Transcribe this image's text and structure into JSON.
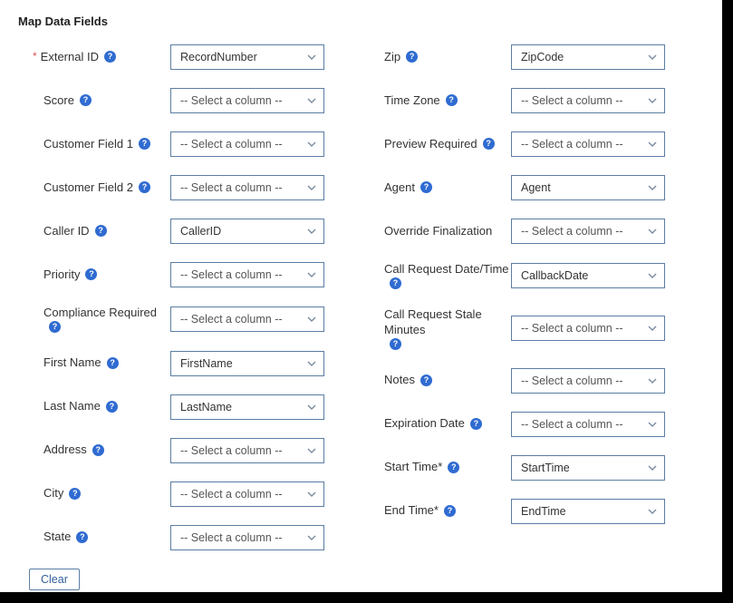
{
  "title": "Map Data Fields",
  "placeholder": "-- Select a column --",
  "left": [
    {
      "key": "external-id",
      "label": "External ID",
      "required": true,
      "help": true,
      "value": "RecordNumber"
    },
    {
      "key": "score",
      "label": "Score",
      "required": false,
      "help": true,
      "value": ""
    },
    {
      "key": "customer-field-1",
      "label": "Customer Field 1",
      "required": false,
      "help": true,
      "value": ""
    },
    {
      "key": "customer-field-2",
      "label": "Customer Field 2",
      "required": false,
      "help": true,
      "value": ""
    },
    {
      "key": "caller-id",
      "label": "Caller ID",
      "required": false,
      "help": true,
      "value": "CallerID"
    },
    {
      "key": "priority",
      "label": "Priority",
      "required": false,
      "help": true,
      "value": ""
    },
    {
      "key": "compliance-required",
      "label": "Compliance Required",
      "required": false,
      "help": true,
      "value": ""
    },
    {
      "key": "first-name",
      "label": "First Name",
      "required": false,
      "help": true,
      "value": "FirstName"
    },
    {
      "key": "last-name",
      "label": "Last Name",
      "required": false,
      "help": true,
      "value": "LastName"
    },
    {
      "key": "address",
      "label": "Address",
      "required": false,
      "help": true,
      "value": ""
    },
    {
      "key": "city",
      "label": "City",
      "required": false,
      "help": true,
      "value": ""
    },
    {
      "key": "state",
      "label": "State",
      "required": false,
      "help": true,
      "value": ""
    }
  ],
  "right": [
    {
      "key": "zip",
      "label": "Zip",
      "required": false,
      "help": true,
      "value": "ZipCode"
    },
    {
      "key": "time-zone",
      "label": "Time Zone",
      "required": false,
      "help": true,
      "value": ""
    },
    {
      "key": "preview-required",
      "label": "Preview Required",
      "required": false,
      "help": true,
      "value": ""
    },
    {
      "key": "agent",
      "label": "Agent",
      "required": false,
      "help": true,
      "value": "Agent"
    },
    {
      "key": "override-finalization",
      "label": "Override Finalization",
      "required": false,
      "help": false,
      "value": ""
    },
    {
      "key": "call-request-datetime",
      "label": "Call Request Date/Time",
      "required": false,
      "help": true,
      "value": "CallbackDate"
    },
    {
      "key": "call-request-stale-minutes",
      "label": "Call Request Stale Minutes",
      "required": false,
      "help": true,
      "value": ""
    },
    {
      "key": "notes",
      "label": "Notes",
      "required": false,
      "help": true,
      "value": ""
    },
    {
      "key": "expiration-date",
      "label": "Expiration Date",
      "required": false,
      "help": true,
      "value": ""
    },
    {
      "key": "start-time",
      "label": "Start Time*",
      "required": false,
      "help": true,
      "value": "StartTime"
    },
    {
      "key": "end-time",
      "label": "End Time*",
      "required": false,
      "help": true,
      "value": "EndTime"
    }
  ],
  "buttons": {
    "clear": "Clear"
  }
}
